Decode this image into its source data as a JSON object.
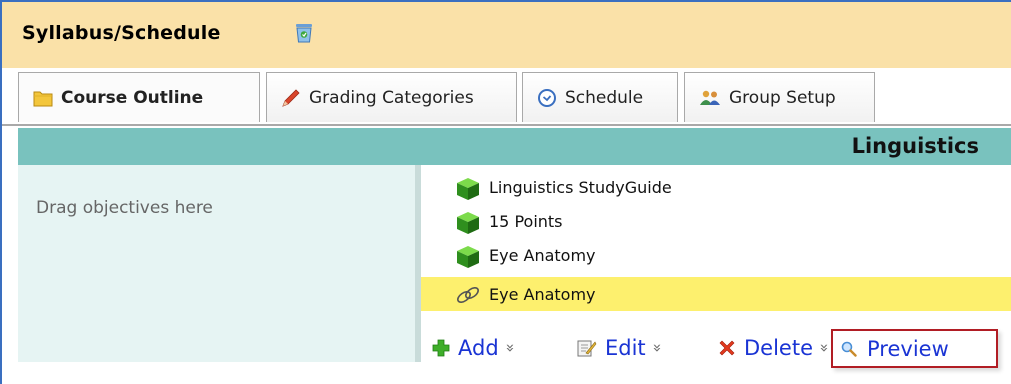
{
  "window": {
    "title": "Syllabus/Schedule"
  },
  "tabs": [
    {
      "label": "Course Outline",
      "icon": "folder-icon",
      "active": true
    },
    {
      "label": "Grading Categories",
      "icon": "pencil-icon",
      "active": false
    },
    {
      "label": "Schedule",
      "icon": "clock-icon",
      "active": false
    },
    {
      "label": "Group Setup",
      "icon": "group-icon",
      "active": false
    }
  ],
  "section": {
    "title": "Linguistics"
  },
  "objectives_panel": {
    "placeholder": "Drag objectives here"
  },
  "outline_items": [
    {
      "label": "Linguistics StudyGuide",
      "icon": "green-cube-icon",
      "selected": false
    },
    {
      "label": "15 Points",
      "icon": "green-cube-icon",
      "selected": false
    },
    {
      "label": "Eye Anatomy",
      "icon": "green-cube-icon",
      "selected": false
    },
    {
      "label": "Eye Anatomy",
      "icon": "link-icon",
      "selected": true
    }
  ],
  "actions": {
    "add": "Add",
    "edit": "Edit",
    "delete": "Delete",
    "preview": "Preview",
    "more_glyph": "»"
  },
  "colors": {
    "title_bar": "#fae1a8",
    "section_header": "#79c2be",
    "selected_row": "#fdf06e",
    "link_blue": "#1a34d4",
    "highlight_border": "#b11d24"
  }
}
